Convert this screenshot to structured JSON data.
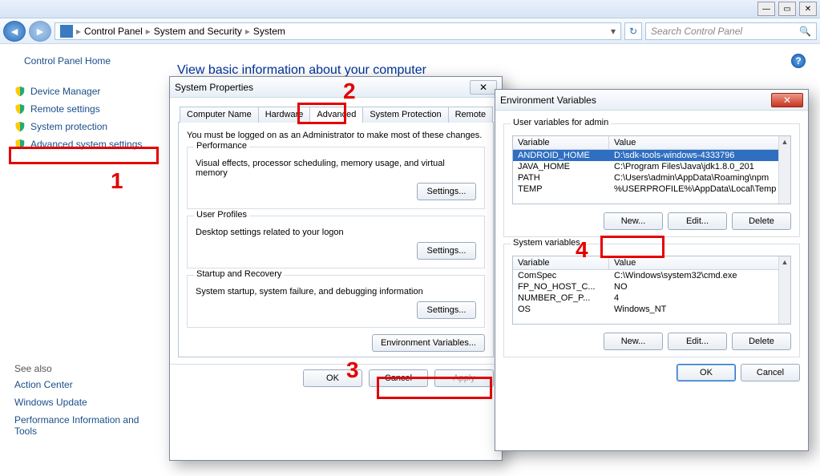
{
  "titlebar": {
    "minimize": "—",
    "maximize": "▭",
    "close": "✕"
  },
  "breadcrumbs": [
    "Control Panel",
    "System and Security",
    "System"
  ],
  "search": {
    "placeholder": "Search Control Panel"
  },
  "sidebar": {
    "home": "Control Panel Home",
    "links": [
      {
        "label": "Device Manager"
      },
      {
        "label": "Remote settings"
      },
      {
        "label": "System protection"
      },
      {
        "label": "Advanced system settings"
      }
    ],
    "see_also_heading": "See also",
    "see_also": [
      {
        "label": "Action Center"
      },
      {
        "label": "Windows Update"
      },
      {
        "label": "Performance Information and Tools"
      }
    ]
  },
  "content": {
    "heading": "View basic information about your computer"
  },
  "markers": {
    "one": "1",
    "two": "2",
    "three": "3",
    "four": "4"
  },
  "sysprops": {
    "title": "System Properties",
    "tabs": [
      "Computer Name",
      "Hardware",
      "Advanced",
      "System Protection",
      "Remote"
    ],
    "active_tab": 2,
    "note": "You must be logged on as an Administrator to make most of these changes.",
    "performance": {
      "legend": "Performance",
      "desc": "Visual effects, processor scheduling, memory usage, and virtual memory",
      "button": "Settings..."
    },
    "profiles": {
      "legend": "User Profiles",
      "desc": "Desktop settings related to your logon",
      "button": "Settings..."
    },
    "startup": {
      "legend": "Startup and Recovery",
      "desc": "System startup, system failure, and debugging information",
      "button": "Settings..."
    },
    "envbtn": "Environment Variables...",
    "ok": "OK",
    "cancel": "Cancel",
    "apply": "Apply"
  },
  "envdlg": {
    "title": "Environment Variables",
    "user_heading": "User variables for admin",
    "sys_heading": "System variables",
    "col_variable": "Variable",
    "col_value": "Value",
    "user_vars": [
      {
        "name": "ANDROID_HOME",
        "value": "D:\\sdk-tools-windows-4333796"
      },
      {
        "name": "JAVA_HOME",
        "value": "C:\\Program Files\\Java\\jdk1.8.0_201"
      },
      {
        "name": "PATH",
        "value": "C:\\Users\\admin\\AppData\\Roaming\\npm"
      },
      {
        "name": "TEMP",
        "value": "%USERPROFILE%\\AppData\\Local\\Temp"
      }
    ],
    "sys_vars": [
      {
        "name": "ComSpec",
        "value": "C:\\Windows\\system32\\cmd.exe"
      },
      {
        "name": "FP_NO_HOST_C...",
        "value": "NO"
      },
      {
        "name": "NUMBER_OF_P...",
        "value": "4"
      },
      {
        "name": "OS",
        "value": "Windows_NT"
      }
    ],
    "new": "New...",
    "edit": "Edit...",
    "delete": "Delete",
    "ok": "OK",
    "cancel": "Cancel"
  }
}
